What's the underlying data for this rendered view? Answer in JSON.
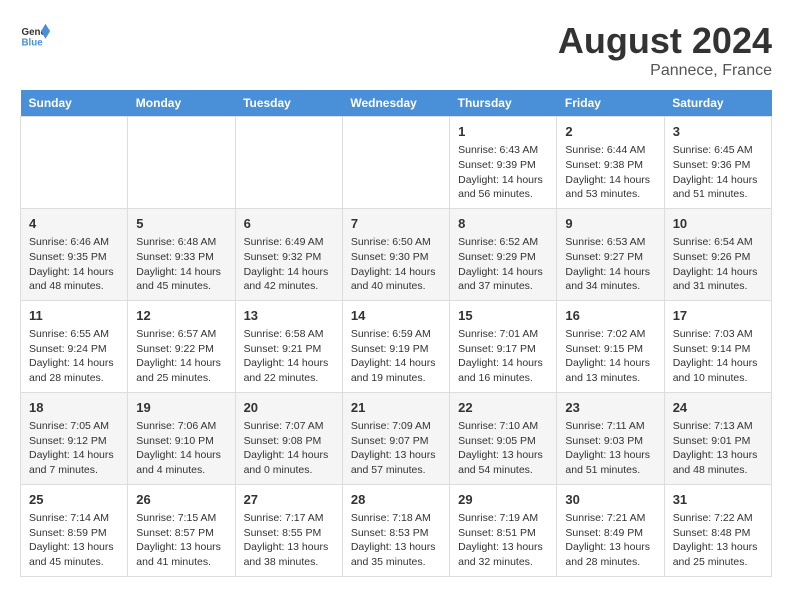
{
  "header": {
    "logo_general": "General",
    "logo_blue": "Blue",
    "month_year": "August 2024",
    "location": "Pannece, France"
  },
  "days_of_week": [
    "Sunday",
    "Monday",
    "Tuesday",
    "Wednesday",
    "Thursday",
    "Friday",
    "Saturday"
  ],
  "weeks": [
    [
      {
        "day": "",
        "info": ""
      },
      {
        "day": "",
        "info": ""
      },
      {
        "day": "",
        "info": ""
      },
      {
        "day": "",
        "info": ""
      },
      {
        "day": "1",
        "info": "Sunrise: 6:43 AM\nSunset: 9:39 PM\nDaylight: 14 hours and 56 minutes."
      },
      {
        "day": "2",
        "info": "Sunrise: 6:44 AM\nSunset: 9:38 PM\nDaylight: 14 hours and 53 minutes."
      },
      {
        "day": "3",
        "info": "Sunrise: 6:45 AM\nSunset: 9:36 PM\nDaylight: 14 hours and 51 minutes."
      }
    ],
    [
      {
        "day": "4",
        "info": "Sunrise: 6:46 AM\nSunset: 9:35 PM\nDaylight: 14 hours and 48 minutes."
      },
      {
        "day": "5",
        "info": "Sunrise: 6:48 AM\nSunset: 9:33 PM\nDaylight: 14 hours and 45 minutes."
      },
      {
        "day": "6",
        "info": "Sunrise: 6:49 AM\nSunset: 9:32 PM\nDaylight: 14 hours and 42 minutes."
      },
      {
        "day": "7",
        "info": "Sunrise: 6:50 AM\nSunset: 9:30 PM\nDaylight: 14 hours and 40 minutes."
      },
      {
        "day": "8",
        "info": "Sunrise: 6:52 AM\nSunset: 9:29 PM\nDaylight: 14 hours and 37 minutes."
      },
      {
        "day": "9",
        "info": "Sunrise: 6:53 AM\nSunset: 9:27 PM\nDaylight: 14 hours and 34 minutes."
      },
      {
        "day": "10",
        "info": "Sunrise: 6:54 AM\nSunset: 9:26 PM\nDaylight: 14 hours and 31 minutes."
      }
    ],
    [
      {
        "day": "11",
        "info": "Sunrise: 6:55 AM\nSunset: 9:24 PM\nDaylight: 14 hours and 28 minutes."
      },
      {
        "day": "12",
        "info": "Sunrise: 6:57 AM\nSunset: 9:22 PM\nDaylight: 14 hours and 25 minutes."
      },
      {
        "day": "13",
        "info": "Sunrise: 6:58 AM\nSunset: 9:21 PM\nDaylight: 14 hours and 22 minutes."
      },
      {
        "day": "14",
        "info": "Sunrise: 6:59 AM\nSunset: 9:19 PM\nDaylight: 14 hours and 19 minutes."
      },
      {
        "day": "15",
        "info": "Sunrise: 7:01 AM\nSunset: 9:17 PM\nDaylight: 14 hours and 16 minutes."
      },
      {
        "day": "16",
        "info": "Sunrise: 7:02 AM\nSunset: 9:15 PM\nDaylight: 14 hours and 13 minutes."
      },
      {
        "day": "17",
        "info": "Sunrise: 7:03 AM\nSunset: 9:14 PM\nDaylight: 14 hours and 10 minutes."
      }
    ],
    [
      {
        "day": "18",
        "info": "Sunrise: 7:05 AM\nSunset: 9:12 PM\nDaylight: 14 hours and 7 minutes."
      },
      {
        "day": "19",
        "info": "Sunrise: 7:06 AM\nSunset: 9:10 PM\nDaylight: 14 hours and 4 minutes."
      },
      {
        "day": "20",
        "info": "Sunrise: 7:07 AM\nSunset: 9:08 PM\nDaylight: 14 hours and 0 minutes."
      },
      {
        "day": "21",
        "info": "Sunrise: 7:09 AM\nSunset: 9:07 PM\nDaylight: 13 hours and 57 minutes."
      },
      {
        "day": "22",
        "info": "Sunrise: 7:10 AM\nSunset: 9:05 PM\nDaylight: 13 hours and 54 minutes."
      },
      {
        "day": "23",
        "info": "Sunrise: 7:11 AM\nSunset: 9:03 PM\nDaylight: 13 hours and 51 minutes."
      },
      {
        "day": "24",
        "info": "Sunrise: 7:13 AM\nSunset: 9:01 PM\nDaylight: 13 hours and 48 minutes."
      }
    ],
    [
      {
        "day": "25",
        "info": "Sunrise: 7:14 AM\nSunset: 8:59 PM\nDaylight: 13 hours and 45 minutes."
      },
      {
        "day": "26",
        "info": "Sunrise: 7:15 AM\nSunset: 8:57 PM\nDaylight: 13 hours and 41 minutes."
      },
      {
        "day": "27",
        "info": "Sunrise: 7:17 AM\nSunset: 8:55 PM\nDaylight: 13 hours and 38 minutes."
      },
      {
        "day": "28",
        "info": "Sunrise: 7:18 AM\nSunset: 8:53 PM\nDaylight: 13 hours and 35 minutes."
      },
      {
        "day": "29",
        "info": "Sunrise: 7:19 AM\nSunset: 8:51 PM\nDaylight: 13 hours and 32 minutes."
      },
      {
        "day": "30",
        "info": "Sunrise: 7:21 AM\nSunset: 8:49 PM\nDaylight: 13 hours and 28 minutes."
      },
      {
        "day": "31",
        "info": "Sunrise: 7:22 AM\nSunset: 8:48 PM\nDaylight: 13 hours and 25 minutes."
      }
    ]
  ]
}
